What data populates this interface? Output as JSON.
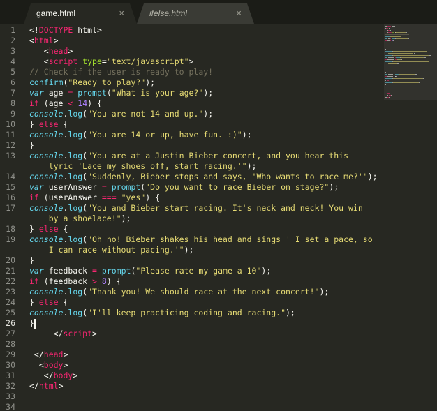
{
  "tabs": [
    {
      "label": "game.html",
      "close": "×",
      "active": true
    },
    {
      "label": "ifelse.html",
      "close": "×",
      "active": false
    }
  ],
  "editor": {
    "current_line": 26,
    "line_numbers": [
      "1",
      "2",
      "3",
      "4",
      "5",
      "6",
      "7",
      "8",
      "9",
      "10",
      "11",
      "12",
      "13",
      "14",
      "15",
      "16",
      "17",
      "18",
      "19",
      "20",
      "21",
      "22",
      "23",
      "24",
      "25",
      "26",
      "27",
      "28",
      "29",
      "30",
      "31",
      "32",
      "33",
      "34"
    ],
    "rows": [
      {
        "ln": "1",
        "tokens": [
          [
            "p",
            "<!"
          ],
          [
            "t",
            "DOCTYPE"
          ],
          [
            "p",
            " html>"
          ]
        ]
      },
      {
        "ln": "2",
        "tokens": [
          [
            "p",
            "<"
          ],
          [
            "t",
            "html"
          ],
          [
            "p",
            ">"
          ]
        ]
      },
      {
        "ln": "3",
        "tokens": [
          [
            "p",
            "   <"
          ],
          [
            "t",
            "head"
          ],
          [
            "p",
            ">"
          ]
        ]
      },
      {
        "ln": "4",
        "tokens": [
          [
            "p",
            "   <"
          ],
          [
            "t",
            "script"
          ],
          [
            "p",
            " "
          ],
          [
            "a",
            "type"
          ],
          [
            "p",
            "="
          ],
          [
            "s",
            "\"text/javascript\""
          ],
          [
            "p",
            ">"
          ]
        ]
      },
      {
        "ln": "5",
        "tokens": [
          [
            "c",
            "// Check if the user is ready to play!"
          ]
        ]
      },
      {
        "ln": "6",
        "tokens": [
          [
            "f",
            "confirm"
          ],
          [
            "p",
            "("
          ],
          [
            "s",
            "\"Ready to play?\""
          ],
          [
            "p",
            ");"
          ]
        ]
      },
      {
        "ln": "7",
        "tokens": [
          [
            "st",
            "var"
          ],
          [
            "p",
            " age "
          ],
          [
            "o",
            "="
          ],
          [
            "p",
            " "
          ],
          [
            "f",
            "prompt"
          ],
          [
            "p",
            "("
          ],
          [
            "s",
            "\"What is your age?\""
          ],
          [
            "p",
            ");"
          ]
        ]
      },
      {
        "ln": "8",
        "tokens": [
          [
            "k",
            "if"
          ],
          [
            "p",
            " (age "
          ],
          [
            "o",
            "<"
          ],
          [
            "p",
            " "
          ],
          [
            "n",
            "14"
          ],
          [
            "p",
            ") {"
          ]
        ]
      },
      {
        "ln": "9",
        "tokens": [
          [
            "st",
            "console"
          ],
          [
            "p",
            "."
          ],
          [
            "f",
            "log"
          ],
          [
            "p",
            "("
          ],
          [
            "s",
            "\"You are not 14 and up.\""
          ],
          [
            "p",
            ");"
          ]
        ]
      },
      {
        "ln": "10",
        "tokens": [
          [
            "p",
            "} "
          ],
          [
            "k",
            "else"
          ],
          [
            "p",
            " {"
          ]
        ]
      },
      {
        "ln": "11",
        "tokens": [
          [
            "st",
            "console"
          ],
          [
            "p",
            "."
          ],
          [
            "f",
            "log"
          ],
          [
            "p",
            "("
          ],
          [
            "s",
            "\"You are 14 or up, have fun. :)\""
          ],
          [
            "p",
            ");"
          ]
        ]
      },
      {
        "ln": "12",
        "tokens": [
          [
            "p",
            "}"
          ]
        ]
      },
      {
        "ln": "13",
        "tokens": [
          [
            "st",
            "console"
          ],
          [
            "p",
            "."
          ],
          [
            "f",
            "log"
          ],
          [
            "p",
            "("
          ],
          [
            "s",
            "\"You are at a Justin Bieber concert, and you hear this"
          ]
        ]
      },
      {
        "ln": "",
        "tokens": [
          [
            "s",
            "    lyric 'Lace my shoes off, start racing.'\""
          ],
          [
            "p",
            ");"
          ]
        ]
      },
      {
        "ln": "14",
        "tokens": [
          [
            "st",
            "console"
          ],
          [
            "p",
            "."
          ],
          [
            "f",
            "log"
          ],
          [
            "p",
            "("
          ],
          [
            "s",
            "\"Suddenly, Bieber stops and says, 'Who wants to race me?'\""
          ],
          [
            "p",
            ");"
          ]
        ]
      },
      {
        "ln": "15",
        "tokens": [
          [
            "st",
            "var"
          ],
          [
            "p",
            " userAnswer "
          ],
          [
            "o",
            "="
          ],
          [
            "p",
            " "
          ],
          [
            "f",
            "prompt"
          ],
          [
            "p",
            "("
          ],
          [
            "s",
            "\"Do you want to race Bieber on stage?\""
          ],
          [
            "p",
            ");"
          ]
        ]
      },
      {
        "ln": "16",
        "tokens": [
          [
            "k",
            "if"
          ],
          [
            "p",
            " (userAnswer "
          ],
          [
            "o",
            "==="
          ],
          [
            "p",
            " "
          ],
          [
            "s",
            "\"yes\""
          ],
          [
            "p",
            ") {"
          ]
        ]
      },
      {
        "ln": "17",
        "tokens": [
          [
            "st",
            "console"
          ],
          [
            "p",
            "."
          ],
          [
            "f",
            "log"
          ],
          [
            "p",
            "("
          ],
          [
            "s",
            "\"You and Bieber start racing. It's neck and neck! You win"
          ]
        ]
      },
      {
        "ln": "",
        "tokens": [
          [
            "s",
            "    by a shoelace!\""
          ],
          [
            "p",
            ");"
          ]
        ]
      },
      {
        "ln": "18",
        "tokens": [
          [
            "p",
            "} "
          ],
          [
            "k",
            "else"
          ],
          [
            "p",
            " {"
          ]
        ]
      },
      {
        "ln": "19",
        "tokens": [
          [
            "st",
            "console"
          ],
          [
            "p",
            "."
          ],
          [
            "f",
            "log"
          ],
          [
            "p",
            "("
          ],
          [
            "s",
            "\"Oh no! Bieber shakes his head and sings ' I set a pace, so"
          ]
        ]
      },
      {
        "ln": "",
        "tokens": [
          [
            "s",
            "    I can race without pacing.'\""
          ],
          [
            "p",
            ");"
          ]
        ]
      },
      {
        "ln": "20",
        "tokens": [
          [
            "p",
            "}"
          ]
        ]
      },
      {
        "ln": "21",
        "tokens": [
          [
            "st",
            "var"
          ],
          [
            "p",
            " feedback "
          ],
          [
            "o",
            "="
          ],
          [
            "p",
            " "
          ],
          [
            "f",
            "prompt"
          ],
          [
            "p",
            "("
          ],
          [
            "s",
            "\"Please rate my game a 10\""
          ],
          [
            "p",
            ");"
          ]
        ]
      },
      {
        "ln": "22",
        "tokens": [
          [
            "k",
            "if"
          ],
          [
            "p",
            " (feedback "
          ],
          [
            "o",
            ">"
          ],
          [
            "p",
            " "
          ],
          [
            "n",
            "8"
          ],
          [
            "p",
            ") {"
          ]
        ]
      },
      {
        "ln": "23",
        "tokens": [
          [
            "st",
            "console"
          ],
          [
            "p",
            "."
          ],
          [
            "f",
            "log"
          ],
          [
            "p",
            "("
          ],
          [
            "s",
            "\"Thank you! We should race at the next concert!\""
          ],
          [
            "p",
            ");"
          ]
        ]
      },
      {
        "ln": "24",
        "tokens": [
          [
            "p",
            "} "
          ],
          [
            "k",
            "else"
          ],
          [
            "p",
            " {"
          ]
        ]
      },
      {
        "ln": "25",
        "tokens": [
          [
            "st",
            "console"
          ],
          [
            "p",
            "."
          ],
          [
            "f",
            "log"
          ],
          [
            "p",
            "("
          ],
          [
            "s",
            "\"I'll keep practicing coding and racing.\""
          ],
          [
            "p",
            ");"
          ]
        ]
      },
      {
        "ln": "26",
        "tokens": [
          [
            "p",
            "}"
          ]
        ]
      },
      {
        "ln": "27",
        "tokens": [
          [
            "p",
            "     </"
          ],
          [
            "t",
            "script"
          ],
          [
            "p",
            ">"
          ]
        ]
      },
      {
        "ln": "28",
        "tokens": []
      },
      {
        "ln": "29",
        "tokens": [
          [
            "p",
            " </"
          ],
          [
            "t",
            "head"
          ],
          [
            "p",
            ">"
          ]
        ]
      },
      {
        "ln": "30",
        "tokens": [
          [
            "p",
            "  <"
          ],
          [
            "t",
            "body"
          ],
          [
            "p",
            ">"
          ]
        ]
      },
      {
        "ln": "31",
        "tokens": [
          [
            "p",
            "   </"
          ],
          [
            "t",
            "body"
          ],
          [
            "p",
            ">"
          ]
        ]
      },
      {
        "ln": "32",
        "tokens": [
          [
            "p",
            "</"
          ],
          [
            "t",
            "html"
          ],
          [
            "p",
            ">"
          ]
        ]
      },
      {
        "ln": "33",
        "tokens": []
      },
      {
        "ln": "34",
        "tokens": []
      }
    ]
  },
  "colors": {
    "background": "#272822",
    "tag": "#f92672",
    "attribute": "#a6e22e",
    "string": "#e6db74",
    "comment": "#75715e",
    "storage": "#66d9ef",
    "number": "#ae81ff"
  }
}
